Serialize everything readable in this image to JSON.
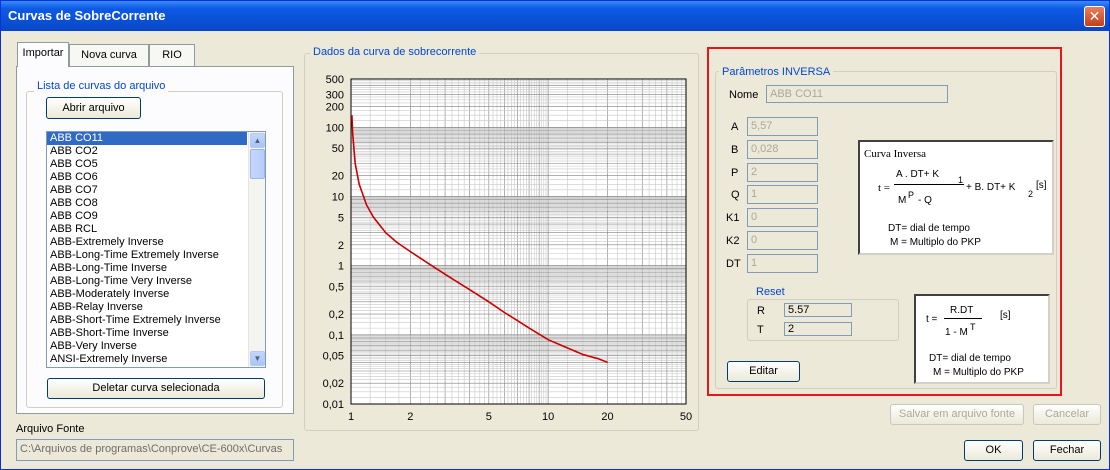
{
  "window": {
    "title": "Curvas de SobreCorrente",
    "close_glyph": "✕"
  },
  "tabs": [
    {
      "label": "Importar",
      "active": true
    },
    {
      "label": "Nova curva",
      "active": false
    },
    {
      "label": "RIO",
      "active": false
    }
  ],
  "import_panel": {
    "group_label": "Lista de curvas do arquivo",
    "open_button": "Abrir arquivo",
    "curves": [
      "ABB CO11",
      "ABB CO2",
      "ABB CO5",
      "ABB CO6",
      "ABB CO7",
      "ABB CO8",
      "ABB CO9",
      "ABB RCL",
      "ABB-Extremely Inverse",
      "ABB-Long-Time Extremely Inverse",
      "ABB-Long-Time Inverse",
      "ABB-Long-Time Very Inverse",
      "ABB-Moderately Inverse",
      "ABB-Relay Inverse",
      "ABB-Short-Time Extremely Inverse",
      "ABB-Short-Time Inverse",
      "ABB-Very Inverse",
      "ANSI-Extremely Inverse"
    ],
    "selected_index": 0,
    "delete_button": "Deletar curva selecionada"
  },
  "source_file": {
    "label": "Arquivo Fonte",
    "value": "C:\\Arquivos de programas\\Conprove\\CE-600x\\Curvas"
  },
  "chart_group_label": "Dados da curva de sobrecorrente",
  "chart_data": {
    "type": "line",
    "x_scale": "log",
    "y_scale": "log",
    "xlim": [
      1,
      50
    ],
    "ylim": [
      0.01,
      500
    ],
    "x_ticks": [
      "1",
      "2",
      "5",
      "10",
      "20",
      "50"
    ],
    "x_tick_values": [
      1,
      2,
      5,
      10,
      20,
      50
    ],
    "y_ticks": [
      "500",
      "300",
      "200",
      "100",
      "50",
      "20",
      "10",
      "5",
      "2",
      "1",
      "0,5",
      "0,2",
      "0,1",
      "0,05",
      "0,02",
      "0,01"
    ],
    "y_tick_values": [
      500,
      300,
      200,
      100,
      50,
      20,
      10,
      5,
      2,
      1,
      0.5,
      0.2,
      0.1,
      0.05,
      0.02,
      0.01
    ],
    "grid": true,
    "series": [
      {
        "color": "#cc0000",
        "x": [
          1.01,
          1.02,
          1.05,
          1.1,
          1.2,
          1.3,
          1.5,
          1.7,
          2,
          2.5,
          3,
          4,
          5,
          6,
          7,
          8,
          10,
          12,
          15,
          18,
          20
        ],
        "y": [
          150,
          80,
          30,
          15,
          7.5,
          5,
          3,
          2.2,
          1.6,
          1.05,
          0.75,
          0.45,
          0.3,
          0.21,
          0.16,
          0.125,
          0.085,
          0.068,
          0.052,
          0.045,
          0.04
        ]
      }
    ]
  },
  "params": {
    "group_label": "Parâmetros INVERSA",
    "name_label": "Nome",
    "name_value": "ABB CO11",
    "fields": [
      {
        "label": "A",
        "value": "5,57"
      },
      {
        "label": "B",
        "value": "0,028"
      },
      {
        "label": "P",
        "value": "2"
      },
      {
        "label": "Q",
        "value": "1"
      },
      {
        "label": "K1",
        "value": "0"
      },
      {
        "label": "K2",
        "value": "0"
      },
      {
        "label": "DT",
        "value": "1"
      }
    ],
    "reset": {
      "label": "Reset",
      "r_label": "R",
      "r_value": "5.57",
      "t_label": "T",
      "t_value": "2"
    },
    "edit_button": "Editar",
    "formula1": {
      "title": "Curva Inversa",
      "t_eq": "t =",
      "numerator": "A . DT+ K",
      "k1_sub": "1",
      "den_m": "M",
      "den_p": "P",
      "den_q": "- Q",
      "rest": "+ B. DT+ K",
      "k2_sub": "2",
      "unit": "[s]",
      "note1": "DT= dial de tempo",
      "note2": "M = Multiplo do PKP"
    },
    "formula2": {
      "t_eq": "t =",
      "numerator": "R.DT",
      "den": "1 - M",
      "den_sup": "T",
      "unit": "[s]",
      "note1": "DT= dial de tempo",
      "note2": "M = Multiplo do PKP"
    }
  },
  "footer": {
    "save_button": "Salvar em arquivo fonte",
    "cancel_button": "Cancelar",
    "ok_button": "OK",
    "close_button": "Fechar"
  }
}
